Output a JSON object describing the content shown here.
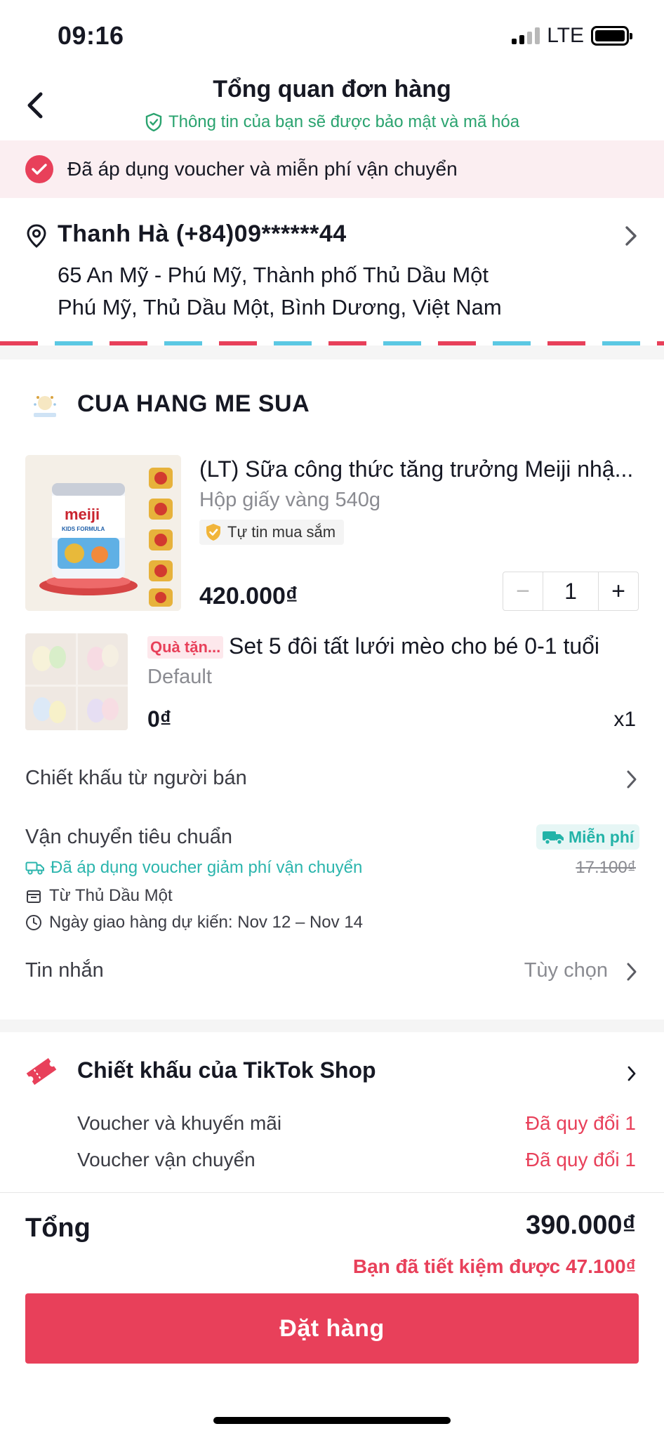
{
  "status_bar": {
    "time": "09:16",
    "network": "LTE"
  },
  "header": {
    "title": "Tổng quan đơn hàng",
    "subtitle": "Thông tin của bạn sẽ được bảo mật và mã hóa",
    "back_icon": "chevron-left-icon"
  },
  "banner": {
    "text": "Đã áp dụng voucher và miễn phí vận chuyển",
    "color": "#e8405a"
  },
  "address": {
    "name_phone": "Thanh Hà (+84)09******44",
    "line1": "65 An Mỹ - Phú Mỹ, Thành phố Thủ Dầu Một",
    "line2": "Phú Mỹ, Thủ Dầu Một, Bình Dương, Việt Nam"
  },
  "store": {
    "name": "CUA HANG ME SUA"
  },
  "product": {
    "title": "(LT) Sữa công thức tăng trưởng Meiji nhậ...",
    "variant": "Hộp giấy vàng 540g",
    "badge": "Tự tin mua sắm",
    "price": "420.000₫",
    "quantity": "1",
    "minus": "−",
    "plus": "+",
    "image_brand": "meiji",
    "image_sub": "KIDS FORMULA"
  },
  "gift": {
    "tag": "Quà tặn...",
    "title": "Set 5 đôi tất lưới mèo cho bé 0-1 tuổi",
    "variant": "Default",
    "price": "0₫",
    "quantity": "x1"
  },
  "seller_discount": {
    "label": "Chiết khấu từ người bán"
  },
  "shipping": {
    "label": "Vận chuyển tiêu chuẩn",
    "free_label": "Miễn phí",
    "voucher_text": "Đã áp dụng voucher giảm phí vận chuyển",
    "old_price": "17.100₫",
    "from": "Từ  Thủ Dầu Một",
    "eta": "Ngày giao hàng dự kiến: Nov 12 – Nov 14",
    "accent": "#23b3a8"
  },
  "message": {
    "label": "Tin nhắn",
    "value": "Tùy chọn"
  },
  "tiktok_discount": {
    "title": "Chiết khấu của TikTok Shop",
    "rows": [
      {
        "label": "Voucher và khuyến mãi",
        "value": "Đã quy đổi 1"
      },
      {
        "label": "Voucher vận chuyển",
        "value": "Đã quy đổi 1"
      }
    ]
  },
  "summary": {
    "total_label": "Tổng",
    "total_value": "390.000₫",
    "saving": "Bạn đã tiết kiệm được 47.100₫",
    "order_button": "Đặt hàng"
  }
}
